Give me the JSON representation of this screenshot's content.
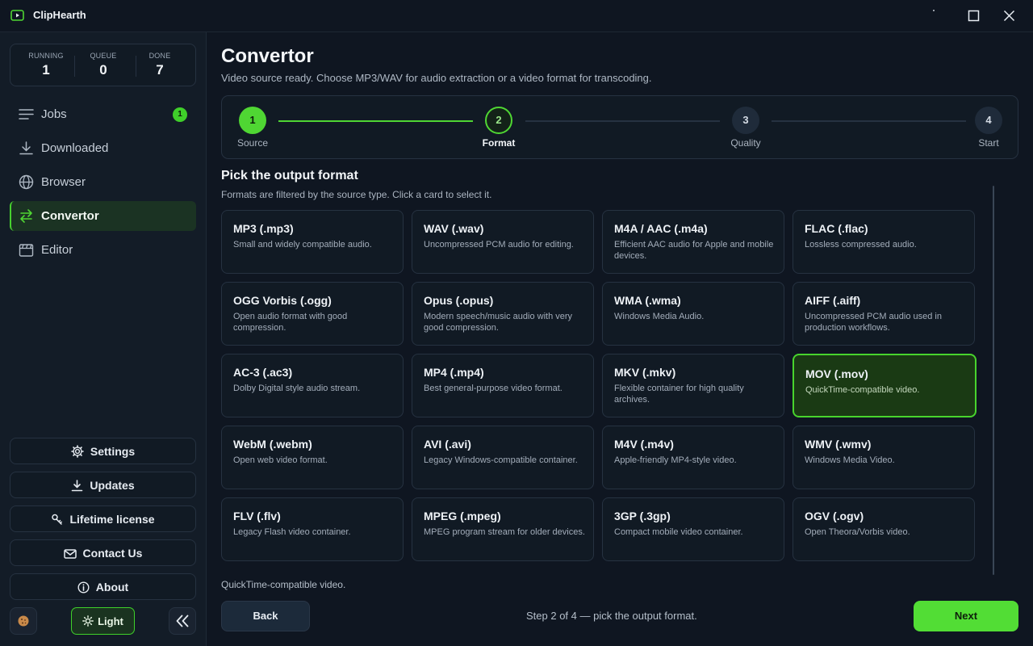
{
  "app": {
    "title": "ClipHearth"
  },
  "stats": [
    {
      "label": "RUNNING",
      "value": "1"
    },
    {
      "label": "QUEUE",
      "value": "0"
    },
    {
      "label": "DONE",
      "value": "7"
    }
  ],
  "nav": [
    {
      "label": "Jobs",
      "icon": "menu-lines-icon",
      "badge": "1"
    },
    {
      "label": "Downloaded",
      "icon": "download-icon"
    },
    {
      "label": "Browser",
      "icon": "globe-icon"
    },
    {
      "label": "Convertor",
      "icon": "swap-arrows-icon",
      "active": true
    },
    {
      "label": "Editor",
      "icon": "clapperboard-icon"
    }
  ],
  "side_buttons": {
    "settings": "Settings",
    "updates": "Updates",
    "license": "Lifetime license",
    "contact": "Contact Us",
    "about": "About"
  },
  "theme_toggle": "Light",
  "page": {
    "title": "Convertor",
    "subtitle": "Video source ready. Choose MP3/WAV for audio extraction or a video format for transcoding."
  },
  "steps": [
    {
      "number": "1",
      "label": "Source",
      "state": "done"
    },
    {
      "number": "2",
      "label": "Format",
      "state": "current"
    },
    {
      "number": "3",
      "label": "Quality",
      "state": "todo"
    },
    {
      "number": "4",
      "label": "Start",
      "state": "todo"
    }
  ],
  "section": {
    "title": "Pick the output format",
    "subtitle": "Formats are filtered by the source type. Click a card to select it."
  },
  "formats": [
    {
      "name": "MP3 (.mp3)",
      "desc": "Small and widely compatible audio."
    },
    {
      "name": "WAV (.wav)",
      "desc": "Uncompressed PCM audio for editing."
    },
    {
      "name": "M4A / AAC (.m4a)",
      "desc": "Efficient AAC audio for Apple and mobile devices."
    },
    {
      "name": "FLAC (.flac)",
      "desc": "Lossless compressed audio."
    },
    {
      "name": "OGG Vorbis (.ogg)",
      "desc": "Open audio format with good compression."
    },
    {
      "name": "Opus (.opus)",
      "desc": "Modern speech/music audio with very good compression."
    },
    {
      "name": "WMA (.wma)",
      "desc": "Windows Media Audio."
    },
    {
      "name": "AIFF (.aiff)",
      "desc": "Uncompressed PCM audio used in production workflows."
    },
    {
      "name": "AC-3 (.ac3)",
      "desc": "Dolby Digital style audio stream."
    },
    {
      "name": "MP4 (.mp4)",
      "desc": "Best general-purpose video format."
    },
    {
      "name": "MKV (.mkv)",
      "desc": "Flexible container for high quality archives."
    },
    {
      "name": "MOV (.mov)",
      "desc": "QuickTime-compatible video.",
      "selected": true
    },
    {
      "name": "WebM (.webm)",
      "desc": "Open web video format."
    },
    {
      "name": "AVI (.avi)",
      "desc": "Legacy Windows-compatible container."
    },
    {
      "name": "M4V (.m4v)",
      "desc": "Apple-friendly MP4-style video."
    },
    {
      "name": "WMV (.wmv)",
      "desc": "Windows Media Video."
    },
    {
      "name": "FLV (.flv)",
      "desc": "Legacy Flash video container."
    },
    {
      "name": "MPEG (.mpeg)",
      "desc": "MPEG program stream for older devices."
    },
    {
      "name": "3GP (.3gp)",
      "desc": "Compact mobile video container."
    },
    {
      "name": "OGV (.ogv)",
      "desc": "Open Theora/Vorbis video."
    }
  ],
  "selected_description": "QuickTime-compatible video.",
  "footer": {
    "back": "Back",
    "status": "Step 2 of 4 — pick the output format.",
    "next": "Next"
  },
  "colors": {
    "accent": "#4fd633",
    "background": "#0f1621",
    "sidebar": "#131c27",
    "card_border": "#263241"
  }
}
